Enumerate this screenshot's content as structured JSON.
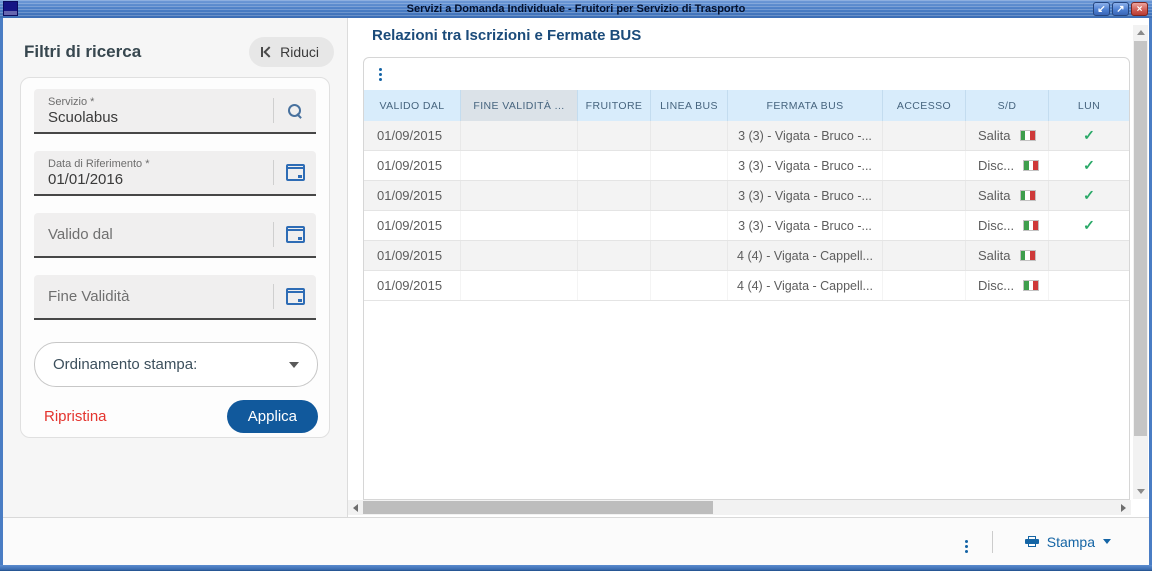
{
  "window": {
    "title": "Servizi a Domanda Individuale - Fruitori per Servizio di Trasporto",
    "controls": {
      "restore_down": "↙",
      "maximize": "↗",
      "close": "×"
    }
  },
  "filters": {
    "title": "Filtri di ricerca",
    "collapse_button": "Riduci",
    "fields": [
      {
        "label": "Servizio *",
        "value": "Scuolabus",
        "icon": "search"
      },
      {
        "label": "Data di Riferimento *",
        "value": "01/01/2016",
        "icon": "calendar"
      },
      {
        "label": "",
        "placeholder": "Valido dal",
        "icon": "calendar"
      },
      {
        "label": "",
        "placeholder": "Fine Validità",
        "icon": "calendar"
      }
    ],
    "sort_dropdown": {
      "label": "Ordinamento stampa:"
    },
    "reset_label": "Ripristina",
    "apply_label": "Applica"
  },
  "main": {
    "title": "Relazioni tra Iscrizioni e Fermate BUS",
    "table": {
      "columns": [
        "VALIDO DAL",
        "FINE VALIDITÀ ...",
        "FRUITORE",
        "LINEA BUS",
        "FERMATA BUS",
        "ACCESSO",
        "S/D",
        "LUN"
      ],
      "highlighted_column": 1,
      "rows": [
        {
          "valido_dal": "01/09/2015",
          "fine_validita": "",
          "fruitore": "",
          "linea_bus": "",
          "fermata_bus": "3 (3) - Vigata - Bruco -...",
          "accesso": "",
          "sd": "Salita",
          "flag": true,
          "lun": true
        },
        {
          "valido_dal": "01/09/2015",
          "fine_validita": "",
          "fruitore": "",
          "linea_bus": "",
          "fermata_bus": "3 (3) - Vigata - Bruco -...",
          "accesso": "",
          "sd": "Disc...",
          "flag": true,
          "lun": true
        },
        {
          "valido_dal": "01/09/2015",
          "fine_validita": "",
          "fruitore": "",
          "linea_bus": "",
          "fermata_bus": "3 (3) - Vigata - Bruco -...",
          "accesso": "",
          "sd": "Salita",
          "flag": true,
          "lun": true
        },
        {
          "valido_dal": "01/09/2015",
          "fine_validita": "",
          "fruitore": "",
          "linea_bus": "",
          "fermata_bus": "3 (3) - Vigata - Bruco -...",
          "accesso": "",
          "sd": "Disc...",
          "flag": true,
          "lun": true
        },
        {
          "valido_dal": "01/09/2015",
          "fine_validita": "",
          "fruitore": "",
          "linea_bus": "",
          "fermata_bus": "4 (4) - Vigata - Cappell...",
          "accesso": "",
          "sd": "Salita",
          "flag": true,
          "lun": false
        },
        {
          "valido_dal": "01/09/2015",
          "fine_validita": "",
          "fruitore": "",
          "linea_bus": "",
          "fermata_bus": "4 (4) - Vigata - Cappell...",
          "accesso": "",
          "sd": "Disc...",
          "flag": true,
          "lun": false
        }
      ]
    }
  },
  "footer": {
    "print_label": "Stampa"
  },
  "icons": {
    "check": "✓",
    "search": "magnifier",
    "calendar": "calendar",
    "collapse": "chevron-bar-left",
    "menu": "vertical-dots",
    "print": "printer",
    "dropdown": "caret-down",
    "flag": "italy-flag"
  },
  "colors": {
    "accent_blue": "#1565a5",
    "titlebar_blue": "#4a7dc4",
    "apply_button_blue": "#11599c",
    "reset_red": "#e4342e",
    "check_green": "#2aa968",
    "header_bg_blue": "#d8ecfb",
    "flag_green": "#3f9e4d",
    "flag_red": "#ce3a3a"
  }
}
